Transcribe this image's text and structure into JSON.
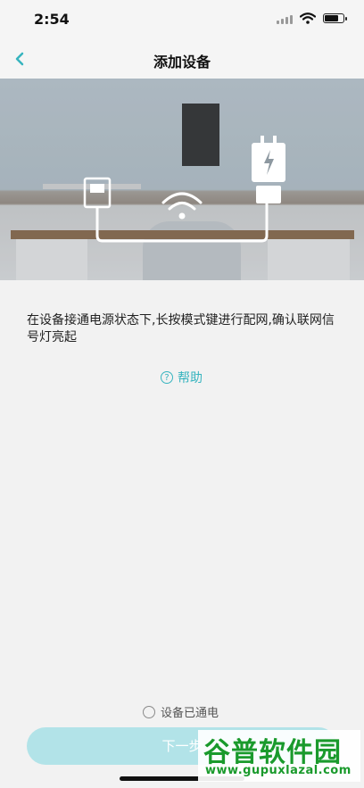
{
  "status_bar": {
    "time": "2:54",
    "battery_level": 0.85
  },
  "nav": {
    "title": "添加设备"
  },
  "instruction": {
    "text": "在设备接通电源状态下,长按模式键进行配网,确认联网信号灯亮起"
  },
  "help": {
    "label": "帮助",
    "icon": "help-circle-icon"
  },
  "confirm": {
    "label": "设备已通电",
    "checked": false
  },
  "next_button": {
    "label": "下一步"
  },
  "watermark": {
    "title": "谷普软件园",
    "url": "www.gupuxlazal.com"
  },
  "colors": {
    "accent": "#37b4bf",
    "button_disabled": "#b2e3e8",
    "watermark": "#1a9a2c"
  }
}
